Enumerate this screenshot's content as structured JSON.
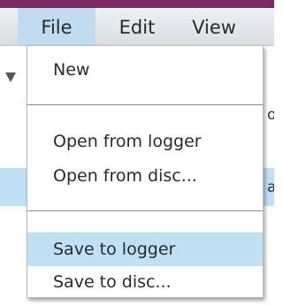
{
  "menubar": {
    "items": [
      {
        "label": "File"
      },
      {
        "label": "Edit"
      },
      {
        "label": "View"
      }
    ]
  },
  "background": {
    "fragment_1": "o",
    "fragment_2": "a"
  },
  "file_menu": {
    "items": [
      {
        "label": "New"
      },
      {
        "label": "Open from logger"
      },
      {
        "label": "Open from disc..."
      },
      {
        "label": "Save to logger"
      },
      {
        "label": "Save to disc..."
      }
    ],
    "highlighted": "Save to logger"
  },
  "colors": {
    "title_strip": "#7a2a63",
    "active_menu": "#c1dcf1",
    "hover_item": "#bfe0f6"
  }
}
